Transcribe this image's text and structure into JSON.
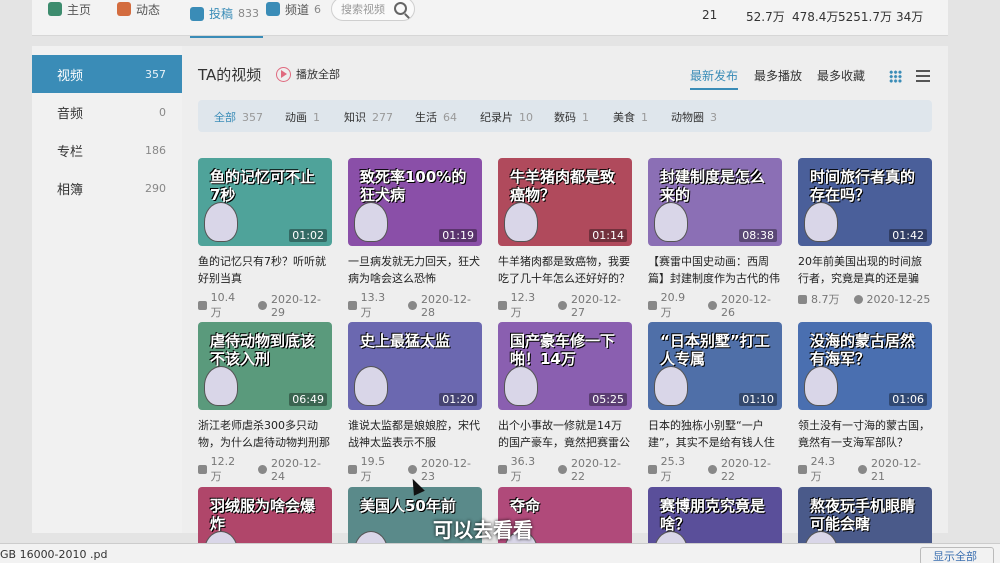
{
  "topnav": {
    "items": [
      {
        "label": "主页",
        "icon": "home-icon",
        "count": ""
      },
      {
        "label": "动态",
        "icon": "activity-icon",
        "count": ""
      },
      {
        "label": "投稿",
        "icon": "upload-icon",
        "count": "833"
      },
      {
        "label": "频道",
        "icon": "channel-icon",
        "count": "6"
      }
    ],
    "search_placeholder": "搜索视频",
    "stats": [
      "21",
      "52.7万",
      "478.4万",
      "5251.7万",
      "34万"
    ]
  },
  "sidebar": {
    "items": [
      {
        "label": "视频",
        "count": "357"
      },
      {
        "label": "音频",
        "count": "0"
      },
      {
        "label": "专栏",
        "count": "186"
      },
      {
        "label": "相簿",
        "count": "290"
      }
    ]
  },
  "main": {
    "title": "TA的视频",
    "play_all": "播放全部",
    "sort_tabs": [
      "最新发布",
      "最多播放",
      "最多收藏"
    ],
    "filters": [
      {
        "label": "全部",
        "count": "357"
      },
      {
        "label": "动画",
        "count": "1"
      },
      {
        "label": "知识",
        "count": "277"
      },
      {
        "label": "生活",
        "count": "64"
      },
      {
        "label": "纪录片",
        "count": "10"
      },
      {
        "label": "数码",
        "count": "1"
      },
      {
        "label": "美食",
        "count": "1"
      },
      {
        "label": "动物圈",
        "count": "3"
      }
    ],
    "videos": [
      {
        "caption": "鱼的记忆可不止7秒",
        "duration": "01:02",
        "title": "鱼的记忆只有7秒？听听就好别当真",
        "plays": "10.4万",
        "date": "2020-12-29",
        "color": "#4fa39a"
      },
      {
        "caption": "致死率100%的狂犬病",
        "duration": "01:19",
        "title": "一旦病发就无力回天，狂犬病为啥会这么恐怖",
        "plays": "13.3万",
        "date": "2020-12-28",
        "color": "#8a4fa8"
      },
      {
        "caption": "牛羊猪肉都是致癌物？",
        "duration": "01:14",
        "title": "牛羊猪肉都是致癌物，我要吃了几十年怎么还好好的？",
        "plays": "12.3万",
        "date": "2020-12-27",
        "color": "#b04a5c"
      },
      {
        "caption": "封建制度是怎么来的",
        "duration": "08:38",
        "title": "【赛雷中国史动画：西周篇】封建制度作为古代的伟大“发",
        "plays": "20.9万",
        "date": "2020-12-26",
        "color": "#8b6fb5"
      },
      {
        "caption": "时间旅行者真的存在吗？",
        "duration": "01:42",
        "title": "20年前美国出现的时间旅行者，究竟是真的还是骗子？",
        "plays": "8.7万",
        "date": "2020-12-25",
        "color": "#4a5f9a"
      },
      {
        "caption": "虐待动物到底该不该入刑",
        "duration": "06:49",
        "title": "浙江老师虐杀300多只动物，为什么虐待动物判刑那么难？",
        "plays": "12.2万",
        "date": "2020-12-24",
        "color": "#5a9a7c"
      },
      {
        "caption": "史上最猛太监",
        "duration": "01:20",
        "title": "谁说太监都是娘娘腔，宋代战神太监表示不服",
        "plays": "19.5万",
        "date": "2020-12-23",
        "color": "#6b68b0"
      },
      {
        "caption": "国产豪车修一下啪！14万",
        "duration": "05:25",
        "title": "出个小事故一修就是14万的国产豪车，竟然把赛雷公关了？",
        "plays": "36.3万",
        "date": "2020-12-22",
        "color": "#8a5fb0"
      },
      {
        "caption": "“日本别墅”打工人专属",
        "duration": "01:10",
        "title": "日本的独栋小别墅“一户建”，其实不是给有钱人住的",
        "plays": "25.3万",
        "date": "2020-12-22",
        "color": "#4f6fa8"
      },
      {
        "caption": "没海的蒙古居然有海军？",
        "duration": "01:06",
        "title": "领土没有一寸海的蒙古国，竟然有一支海军部队？",
        "plays": "24.3万",
        "date": "2020-12-21",
        "color": "#4a6fb0"
      },
      {
        "caption": "羽绒服为啥会爆炸",
        "duration": "",
        "title": "",
        "plays": "",
        "date": "",
        "color": "#b0466a"
      },
      {
        "caption": "美国人50年前",
        "duration": "",
        "title": "",
        "plays": "",
        "date": "",
        "color": "#5a8a8a"
      },
      {
        "caption": "夺命",
        "duration": "",
        "title": "",
        "plays": "",
        "date": "",
        "color": "#b04a7a"
      },
      {
        "caption": "赛博朋克究竟是啥？",
        "duration": "",
        "title": "",
        "plays": "",
        "date": "",
        "color": "#5a4f9a"
      },
      {
        "caption": "熬夜玩手机眼睛可能会瞎",
        "duration": "",
        "title": "",
        "plays": "",
        "date": "",
        "color": "#4a5a8a"
      }
    ]
  },
  "subtitle": "可以去看看",
  "bottombar": {
    "file": "GB 16000-2010 .pd",
    "button": "显示全部"
  }
}
